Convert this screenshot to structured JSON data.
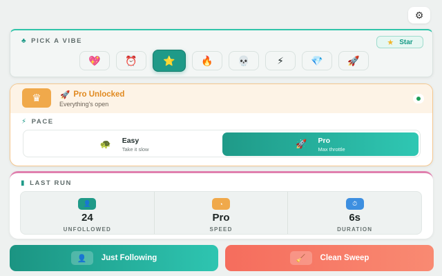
{
  "header": {
    "settings_icon": "gear-icon"
  },
  "vibe": {
    "label": "PICK A VIBE",
    "badge_label": "Star",
    "selected": "star",
    "options": [
      {
        "id": "heart",
        "icon": "heart-icon",
        "glyph": "💖"
      },
      {
        "id": "alarm",
        "icon": "alarm-clock-icon",
        "glyph": "⏰"
      },
      {
        "id": "star",
        "icon": "star-icon",
        "glyph": "⭐"
      },
      {
        "id": "fire",
        "icon": "fire-icon",
        "glyph": "🔥"
      },
      {
        "id": "skull",
        "icon": "skull-icon",
        "glyph": "💀"
      },
      {
        "id": "bolt",
        "icon": "lightning-icon",
        "glyph": "⚡"
      },
      {
        "id": "gem",
        "icon": "gem-icon",
        "glyph": "💎"
      },
      {
        "id": "rocket",
        "icon": "rocket-icon",
        "glyph": "🚀"
      }
    ]
  },
  "pro": {
    "title": "Pro Unlocked",
    "subtitle": "Everything's open",
    "status": "active"
  },
  "pace": {
    "label": "PACE",
    "selected": "pro",
    "options": [
      {
        "id": "easy",
        "name": "Easy",
        "desc": "Take it slow",
        "icon": "turtle-icon"
      },
      {
        "id": "pro",
        "name": "Pro",
        "desc": "Max throttle",
        "icon": "rocket-icon"
      }
    ]
  },
  "last_run": {
    "label": "LAST RUN",
    "stats": [
      {
        "value": "24",
        "label": "UNFOLLOWED",
        "icon": "user-minus-icon",
        "color": "#1f9a88"
      },
      {
        "value": "Pro",
        "label": "SPEED",
        "icon": "speedometer-icon",
        "color": "#f0a94b"
      },
      {
        "value": "6s",
        "label": "DURATION",
        "icon": "timer-icon",
        "color": "#3d8fe0"
      }
    ]
  },
  "actions": {
    "following_label": "Just Following",
    "sweep_label": "Clean Sweep"
  },
  "colors": {
    "accent": "#1f9a88",
    "pro_accent": "#e0891f",
    "danger": "#f56d5d"
  }
}
